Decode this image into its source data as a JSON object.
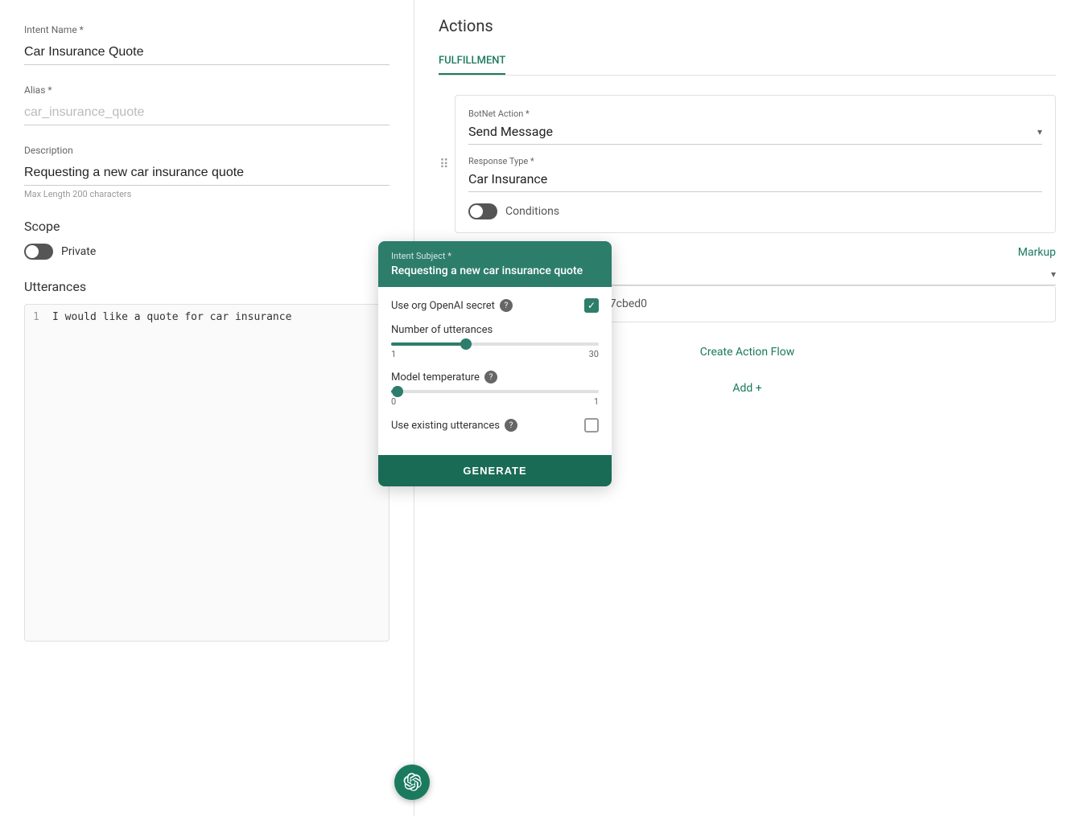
{
  "left": {
    "intent_name_label": "Intent Name *",
    "intent_name_value": "Car Insurance Quote",
    "alias_label": "Alias *",
    "alias_placeholder": "car_insurance_quote",
    "description_label": "Description",
    "description_value": "Requesting a new car insurance quote",
    "description_max_length": "Max Length 200 characters",
    "scope_title": "Scope",
    "private_label": "Private",
    "utterances_title": "Utterances",
    "utterance_line_number": "1",
    "utterance_text": "I would like a quote for car insurance"
  },
  "ai_popup": {
    "subject_label": "Intent Subject *",
    "subject_value": "Requesting a new car insurance quote",
    "use_org_secret_label": "Use org OpenAI secret",
    "number_utterances_label": "Number of utterances",
    "utterances_min": "1",
    "utterances_max": "30",
    "model_temperature_label": "Model temperature",
    "temp_min": "0",
    "temp_max": "1",
    "use_existing_label": "Use existing utterances",
    "generate_button": "GENERATE"
  },
  "right": {
    "actions_title": "Actions",
    "tab_fulfillment": "FULFILLMENT",
    "botnet_action_label": "BotNet Action *",
    "botnet_action_value": "Send Message",
    "response_type_label": "Response Type *",
    "response_type_value": "Car Insurance",
    "conditions_label": "Conditions",
    "markup_link": "Markup",
    "uuid_value": "da53d-287d-42c9-9104-552d287cbed0",
    "create_action_flow": "Create Action Flow",
    "add_plus": "Add +"
  }
}
